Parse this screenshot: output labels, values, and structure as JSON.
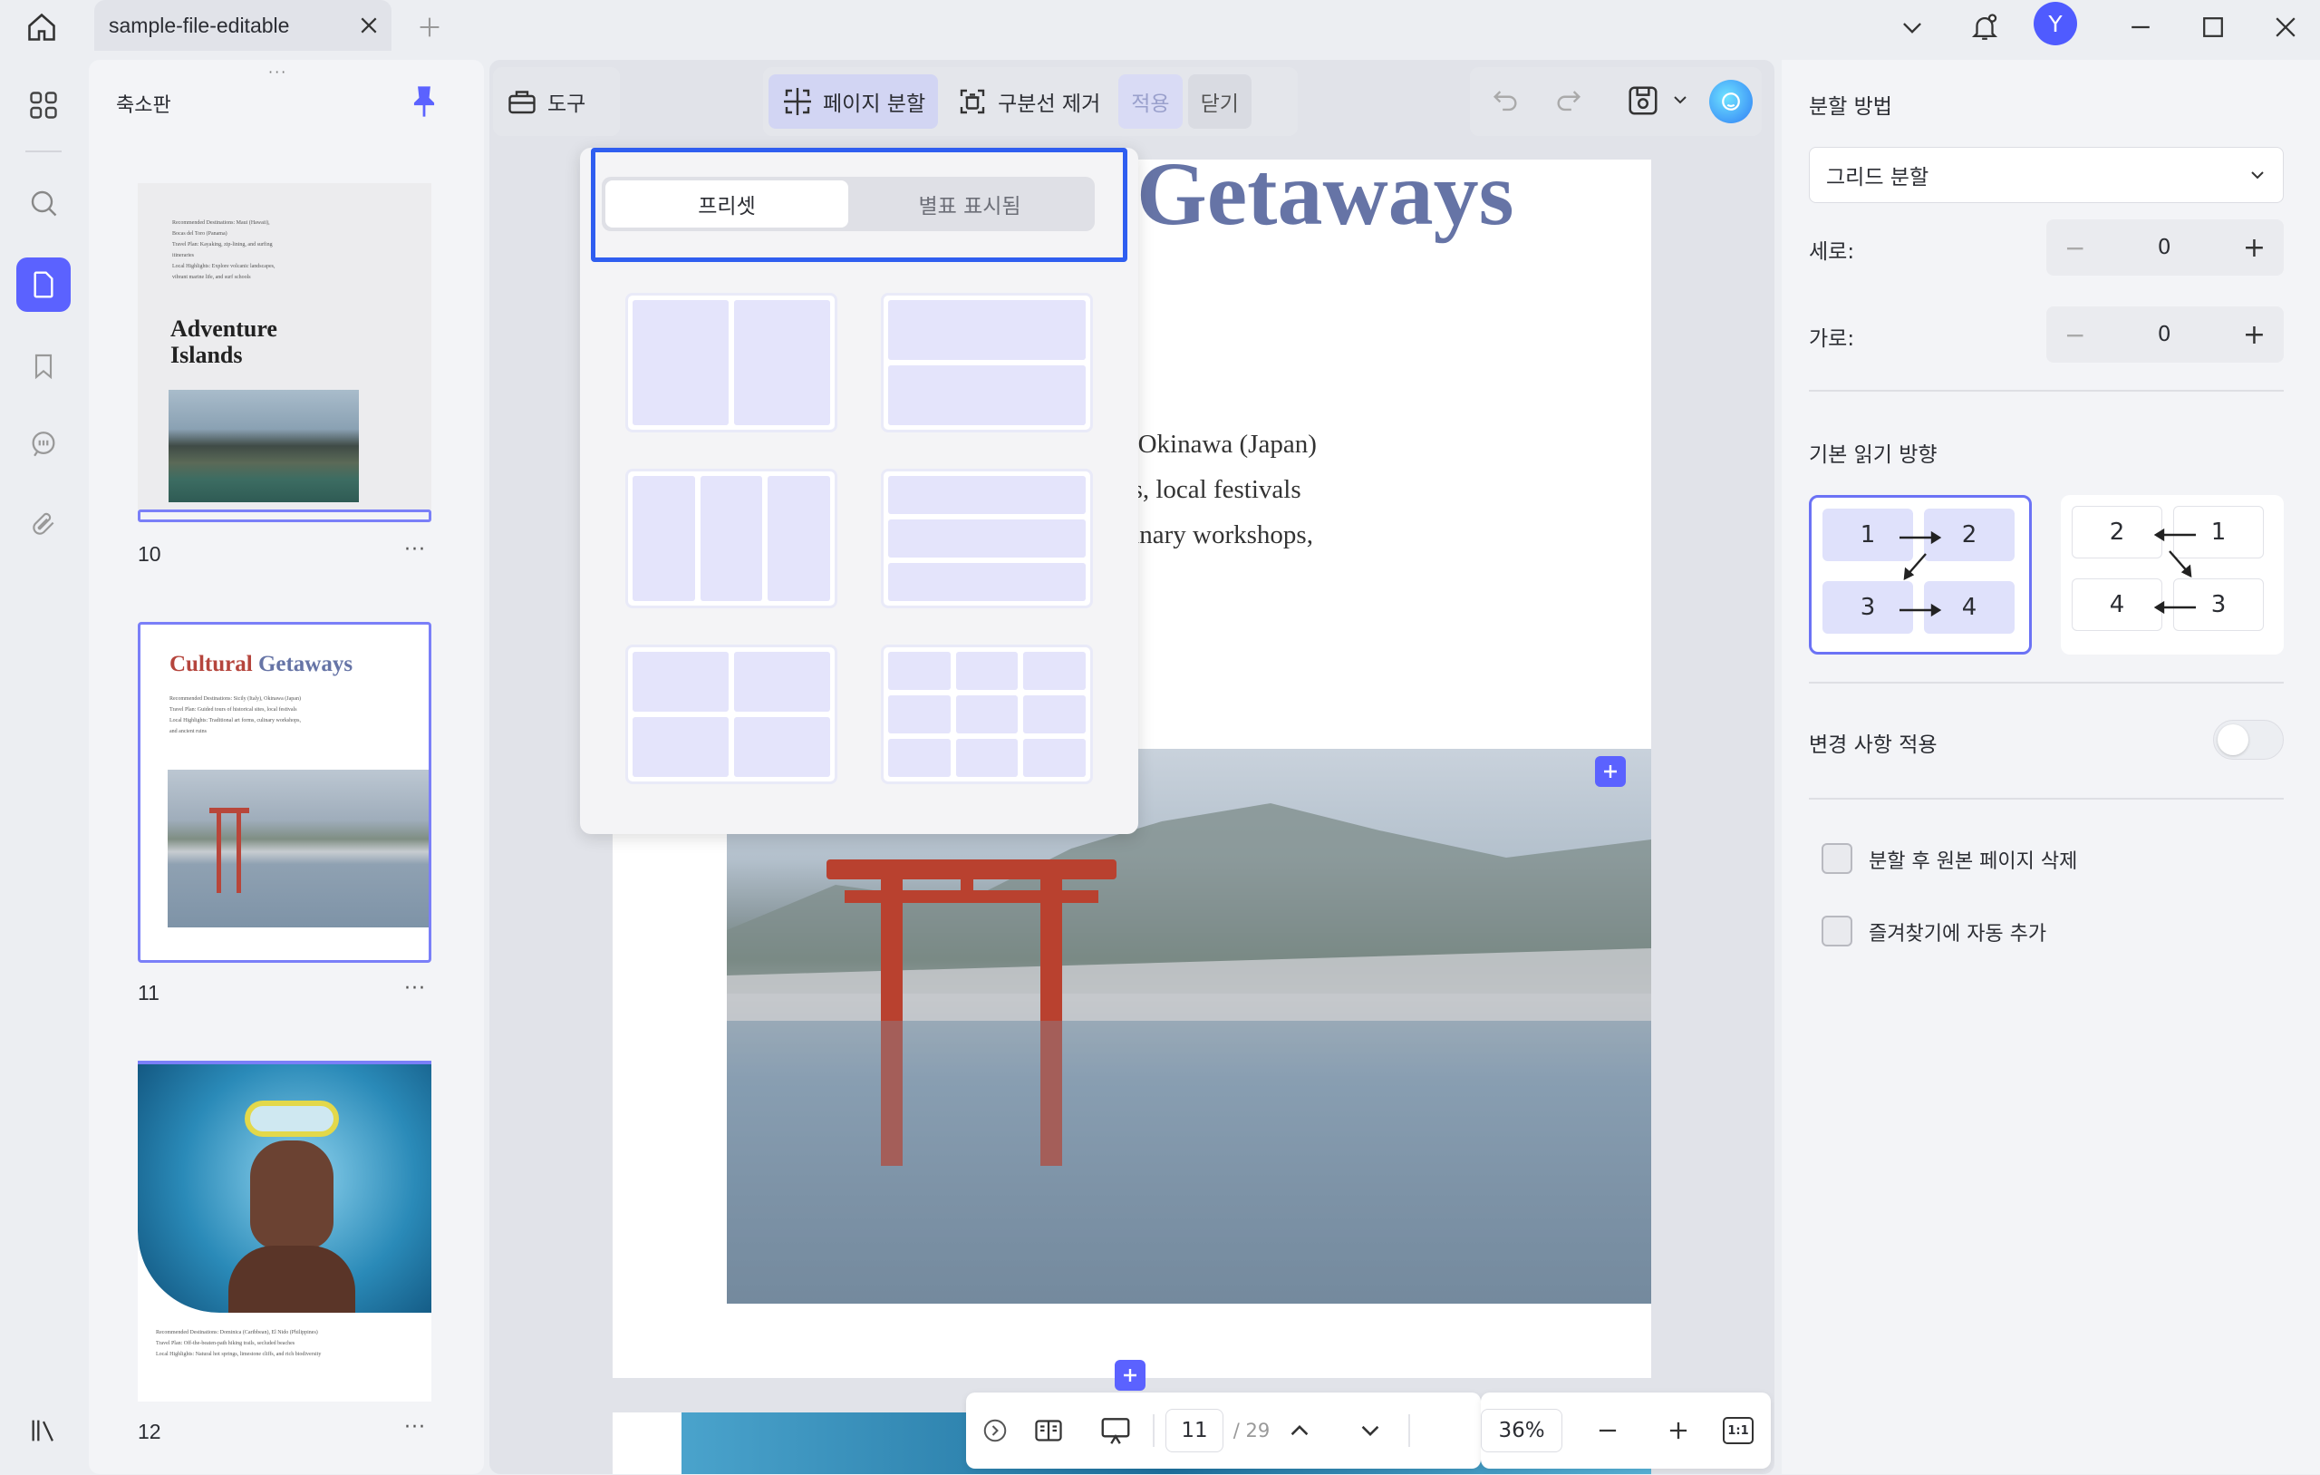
{
  "window": {
    "tab_title": "sample-file-editable",
    "avatar_initial": "Y"
  },
  "thumbnail_panel": {
    "title": "축소판",
    "pages": [
      {
        "number": "10",
        "lines": [
          "Recommended Destinations: Maui (Hawaii),",
          "Bocas del Toro (Panama)",
          "Travel Plan: Kayaking, zip-lining, and surfing",
          "itineraries",
          "Local Highlights: Explore volcanic landscapes,",
          "vibrant marine life, and surf schools"
        ],
        "heading": "Adventure\nIslands"
      },
      {
        "number": "11",
        "heading_a": "Cultural",
        "heading_b": "Getaways",
        "lines": [
          "Recommended Destinations: Sicily (Italy), Okinawa (Japan)",
          "Travel Plan: Guided tours of historical sites, local festivals",
          "Local Highlights: Traditional art forms, culinary workshops,",
          "and ancient ruins"
        ]
      },
      {
        "number": "12",
        "lines": [
          "Recommended Destinations: Dominica (Caribbean), El Nido (Philippines)",
          "Travel Plan: Off-the-beaten-path hiking trails, secluded beaches",
          "Local Highlights: Natural hot springs, limestone cliffs, and rich biodiversity"
        ]
      }
    ],
    "more": "···"
  },
  "toolbar": {
    "tools": "도구",
    "split_page": "페이지 분할",
    "remove_divider": "구분선 제거",
    "apply": "적용",
    "close": "닫기"
  },
  "preset_popup": {
    "tab_preset": "프리셋",
    "tab_custom": "별표 표시됨"
  },
  "page": {
    "title": "Getaways",
    "lines": [
      "aly), Okinawa (Japan)",
      "l sites, local festivals",
      "s, culinary workshops,"
    ]
  },
  "bottom_bar": {
    "current_page": "11",
    "total_pages": "/ 29",
    "zoom": "36%",
    "fit_label": "1:1"
  },
  "right_panel": {
    "split_method_label": "분할 방법",
    "split_method_value": "그리드 분할",
    "rows_label": "세로:",
    "rows_value": "0",
    "cols_label": "가로:",
    "cols_value": "0",
    "reading_dir_label": "기본 읽기 방향",
    "dir_ltr": [
      "1",
      "2",
      "3",
      "4"
    ],
    "dir_rtl": [
      "2",
      "1",
      "4",
      "3"
    ],
    "apply_changes_label": "변경 사항 적용",
    "checkbox_delete_original": "분할 후 원본 페이지 삭제",
    "checkbox_add_bookmark": "즐겨찾기에 자동 추가"
  },
  "colors": {
    "accent": "#5b62ff",
    "selection_border": "#2f5ef0",
    "title_blue": "#6674a6",
    "title_red": "#b5453d"
  }
}
